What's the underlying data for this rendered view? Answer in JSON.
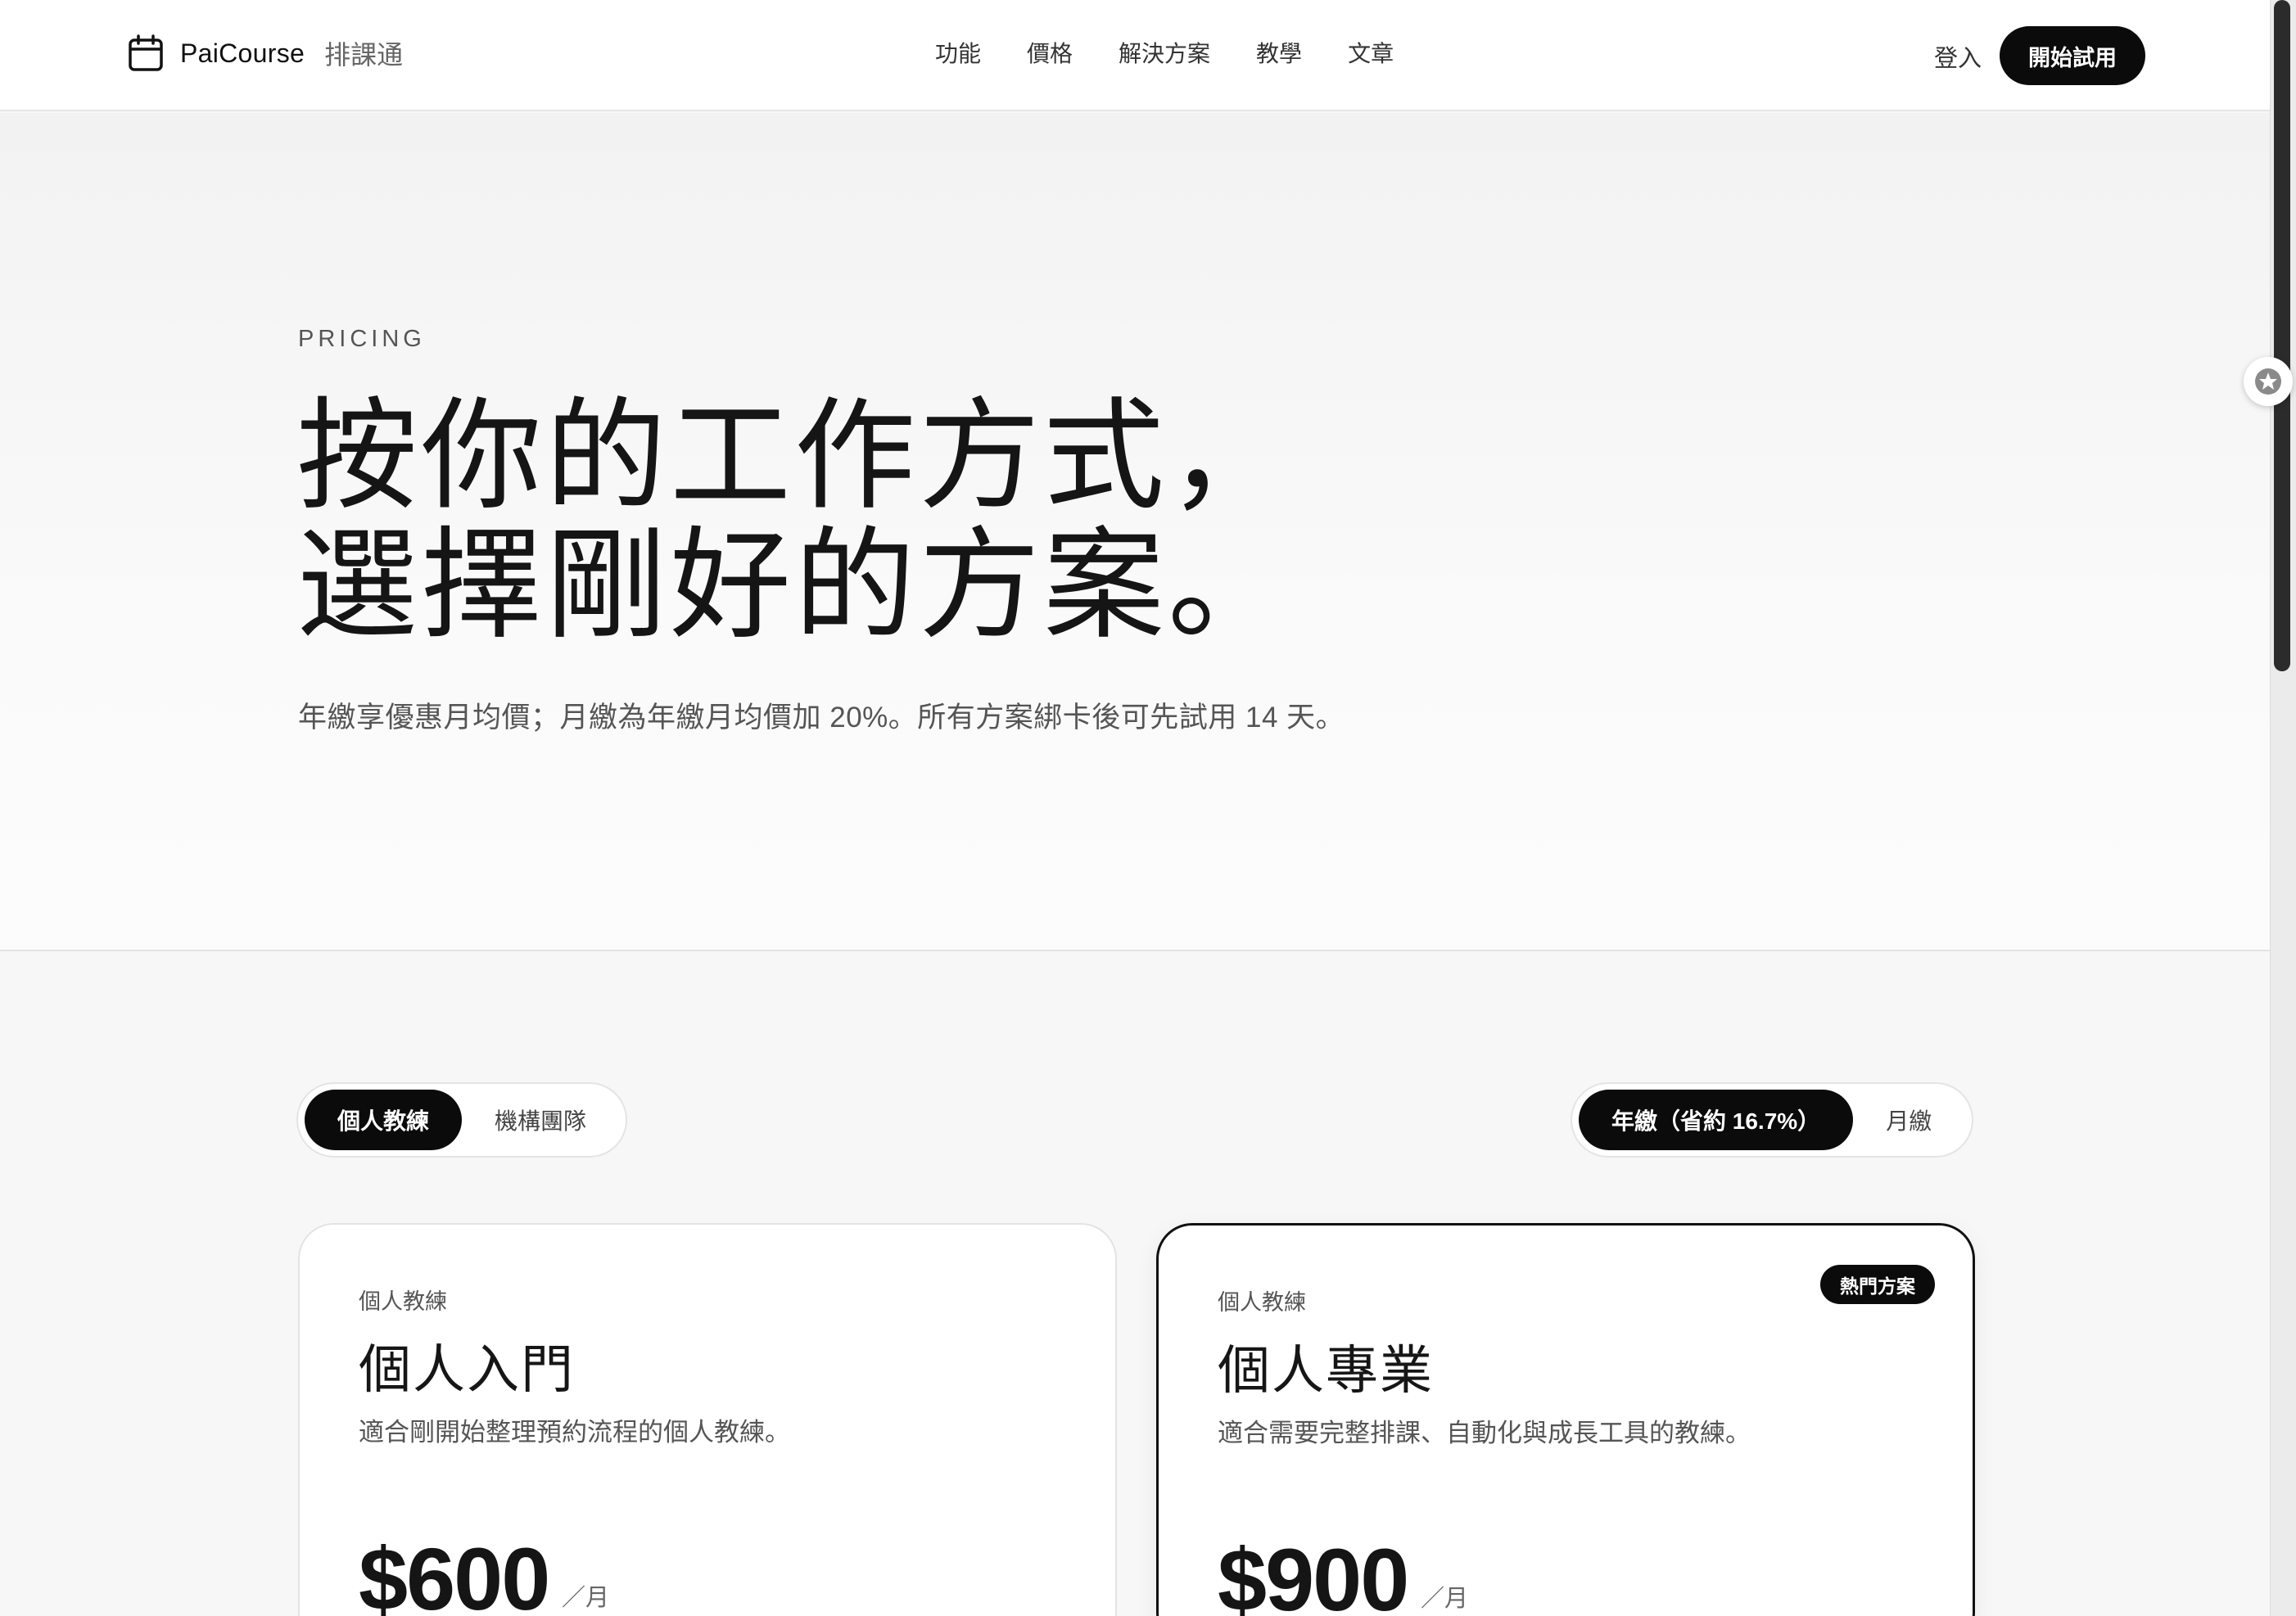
{
  "brand": {
    "name": "PaiCourse",
    "sub": "排課通"
  },
  "nav": {
    "items": [
      "功能",
      "價格",
      "解決方案",
      "教學",
      "文章"
    ]
  },
  "header": {
    "login": "登入",
    "cta": "開始試用"
  },
  "hero": {
    "eyebrow": "PRICING",
    "headline_line1": "按你的工作方式，",
    "headline_line2": "選擇剛好的方案。",
    "subtitle": "年繳享優惠月均價；月繳為年繳月均價加 20%。所有方案綁卡後可先試用 14 天。"
  },
  "audience_toggle": {
    "options": [
      "個人教練",
      "機構團隊"
    ],
    "selected": "個人教練"
  },
  "billing_toggle": {
    "options": [
      "年繳（省約 16.7%）",
      "月繳"
    ],
    "selected": "年繳（省約 16.7%）"
  },
  "plans": [
    {
      "tag": "個人教練",
      "title": "個人入門",
      "desc": "適合剛開始整理預約流程的個人教練。",
      "price": "$600",
      "unit": "／月",
      "badge": ""
    },
    {
      "tag": "個人教練",
      "title": "個人專業",
      "desc": "適合需要完整排課、自動化與成長工具的教練。",
      "price": "$900",
      "unit": "／月",
      "badge": "熱門方案"
    }
  ],
  "icons": {
    "logo": "calendar-icon",
    "side": "star-icon"
  }
}
